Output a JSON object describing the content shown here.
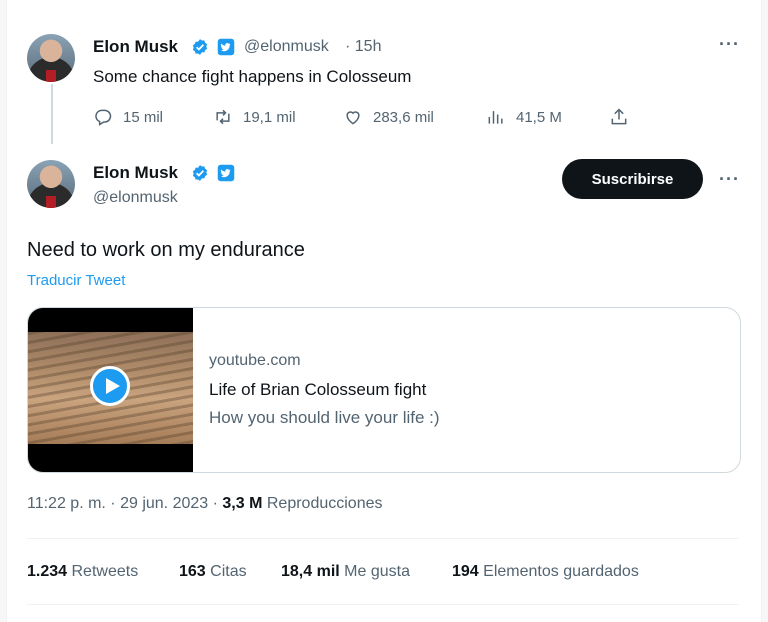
{
  "parent_tweet": {
    "name": "Elon Musk",
    "handle": "@elonmusk",
    "time": "· 15h",
    "text": "Some chance fight happens in Colosseum",
    "replies": "15 mil",
    "retweets": "19,1 mil",
    "likes": "283,6 mil",
    "views": "41,5 M"
  },
  "main_tweet": {
    "name": "Elon Musk",
    "handle": "@elonmusk",
    "subscribe_label": "Suscribirse",
    "text": "Need to work on my endurance",
    "translate_label": "Traducir Tweet",
    "card": {
      "domain": "youtube.com",
      "title": "Life of Brian Colosseum fight",
      "description": "How you should live your life :)"
    },
    "timestamp": "11:22 p. m. · 29 jun. 2023 ·",
    "views_count": "3,3 M",
    "views_label": "Reproducciones",
    "stats": [
      {
        "count": "1.234",
        "label": "Retweets"
      },
      {
        "count": "163",
        "label": "Citas"
      },
      {
        "count": "18,4 mil",
        "label": "Me gusta"
      },
      {
        "count": "194",
        "label": "Elementos guardados"
      }
    ]
  },
  "colors": {
    "verified": "#1d9bf0",
    "link": "#1d9bf0",
    "text": "#0f1419",
    "muted": "#536471"
  }
}
